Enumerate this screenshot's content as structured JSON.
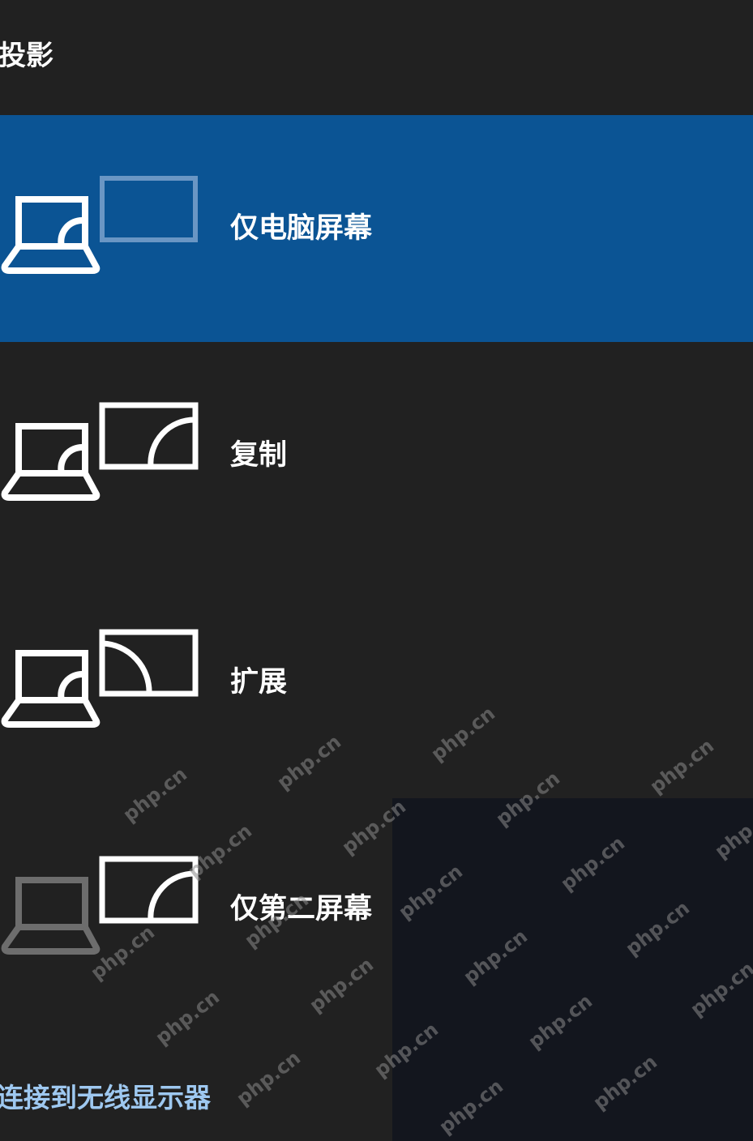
{
  "panel": {
    "title": "投影"
  },
  "options": [
    {
      "label": "仅电脑屏幕",
      "icon": "pc-screen-only-icon",
      "selected": true
    },
    {
      "label": "复制",
      "icon": "duplicate-icon",
      "selected": false
    },
    {
      "label": "扩展",
      "icon": "extend-icon",
      "selected": false
    },
    {
      "label": "仅第二屏幕",
      "icon": "second-screen-only-icon",
      "selected": false
    }
  ],
  "wireless": {
    "label": "连接到无线显示器"
  },
  "watermark": {
    "text": "php.cn"
  },
  "colors": {
    "background": "#212121",
    "selected": "#0b5494",
    "link": "#9ec8f0",
    "icon_dim": "#6d6d6d",
    "icon_selected_monitor": "#6a96c4"
  }
}
